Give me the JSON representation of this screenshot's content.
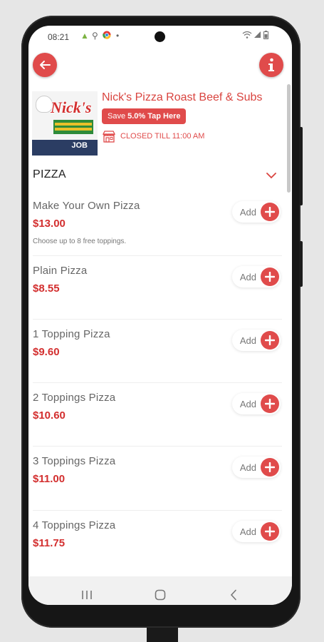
{
  "status_bar": {
    "time": "08:21",
    "icons": [
      "android-icon",
      "key-icon",
      "chrome-icon",
      "dot-icon",
      "wifi-icon",
      "signal-icon",
      "battery-icon"
    ]
  },
  "header": {
    "back_icon": "arrow-left-icon",
    "info_icon": "info-icon"
  },
  "restaurant": {
    "name": "Nick's Pizza Roast Beef & Subs",
    "logo_text": "Nick's",
    "logo_job": "JOB",
    "save_prefix": "Save",
    "save_strong": "5.0% Tap Here",
    "status": "CLOSED TILL 11:00 AM"
  },
  "section": {
    "title": "PIZZA",
    "expanded": true
  },
  "items": [
    {
      "name": "Make Your Own Pizza",
      "price": "$13.00",
      "desc": "Choose up to 8 free toppings.",
      "add": "Add"
    },
    {
      "name": "Plain Pizza",
      "price": "$8.55",
      "desc": "",
      "add": "Add"
    },
    {
      "name": "1 Topping Pizza",
      "price": "$9.60",
      "desc": "",
      "add": "Add"
    },
    {
      "name": "2 Toppings Pizza",
      "price": "$10.60",
      "desc": "",
      "add": "Add"
    },
    {
      "name": "3 Toppings Pizza",
      "price": "$11.00",
      "desc": "",
      "add": "Add"
    },
    {
      "name": "4 Toppings Pizza",
      "price": "$11.75",
      "desc": "",
      "add": "Add"
    }
  ],
  "nav": [
    "recent-apps-icon",
    "home-icon",
    "back-icon"
  ],
  "colors": {
    "accent": "#e04b4b",
    "price": "#d32f2f"
  }
}
